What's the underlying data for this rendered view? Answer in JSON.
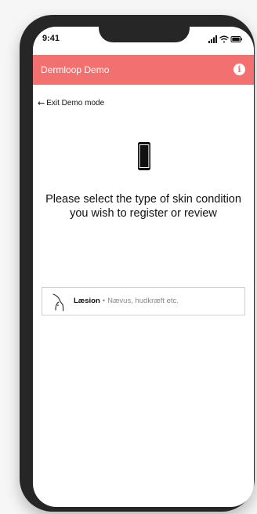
{
  "status_bar": {
    "time": "9:41",
    "icons": [
      "signal-icon",
      "wifi-icon",
      "battery-icon"
    ]
  },
  "header": {
    "title": "Dermloop Demo",
    "info_icon": "info-icon",
    "info_glyph": "i"
  },
  "exit": {
    "arrow": "←",
    "label": "Exit Demo mode"
  },
  "main": {
    "prompt": "Please select the type of skin condition you wish to register or review",
    "options": [
      {
        "title": "Læsion",
        "separator": "•",
        "description": "Nævus, hudkræft etc."
      }
    ]
  },
  "colors": {
    "header_bg": "#f2706f",
    "frame": "#262626"
  }
}
